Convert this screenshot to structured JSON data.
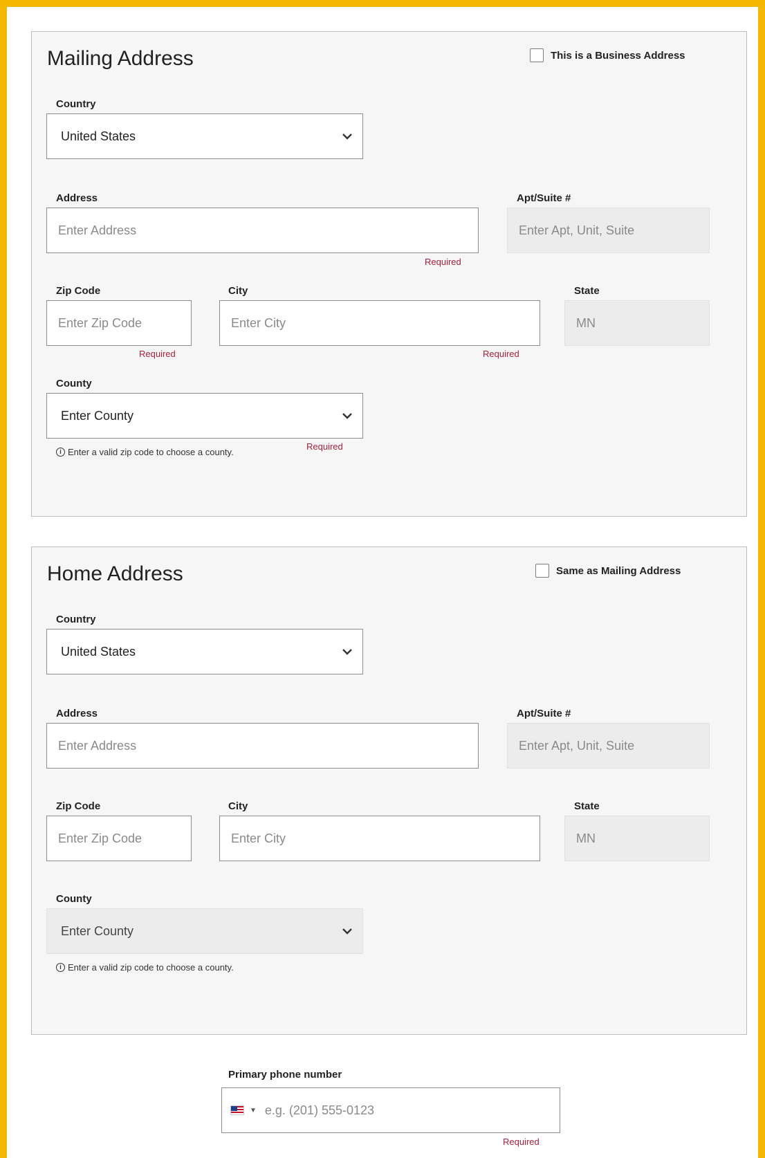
{
  "mailing": {
    "title": "Mailing Address",
    "business_checkbox_label": "This is a Business Address",
    "country_label": "Country",
    "country_value": "United States",
    "address_label": "Address",
    "address_placeholder": "Enter Address",
    "apt_label": "Apt/Suite #",
    "apt_placeholder": "Enter Apt, Unit, Suite",
    "zip_label": "Zip Code",
    "zip_placeholder": "Enter Zip Code",
    "city_label": "City",
    "city_placeholder": "Enter City",
    "state_label": "State",
    "state_value": "MN",
    "county_label": "County",
    "county_placeholder": "Enter County",
    "required_text": "Required",
    "county_hint": "Enter a valid zip code to choose a county."
  },
  "home": {
    "title": "Home Address",
    "same_checkbox_label": "Same as Mailing Address",
    "country_label": "Country",
    "country_value": "United States",
    "address_label": "Address",
    "address_placeholder": "Enter Address",
    "apt_label": "Apt/Suite #",
    "apt_placeholder": "Enter Apt, Unit, Suite",
    "zip_label": "Zip Code",
    "zip_placeholder": "Enter Zip Code",
    "city_label": "City",
    "city_placeholder": "Enter City",
    "state_label": "State",
    "state_value": "MN",
    "county_label": "County",
    "county_placeholder": "Enter County",
    "county_hint": "Enter a valid zip code to choose a county."
  },
  "phone": {
    "label": "Primary phone number",
    "placeholder": "e.g. (201) 555-0123",
    "required_text": "Required",
    "country_flag": "us-flag-icon"
  },
  "colors": {
    "frame": "#f5b800",
    "required": "#a8203c",
    "card_bg": "#f6f6f6"
  }
}
